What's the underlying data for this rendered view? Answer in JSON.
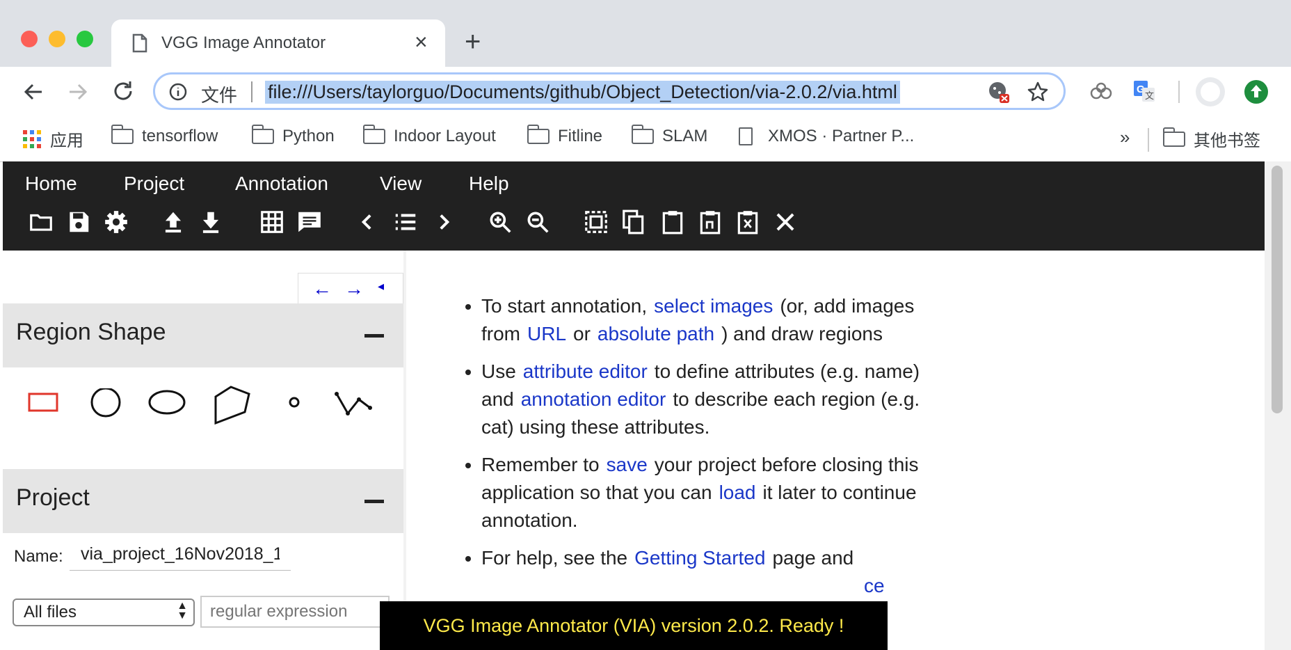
{
  "browser": {
    "tab_title": "VGG Image Annotator",
    "new_tab": "+",
    "tab_close": "×",
    "info_label": "文件",
    "url": "file:///Users/taylorguo/Documents/github/Object_Detection/via-2.0.2/via.html",
    "bookmarks": [
      {
        "label": "应用",
        "icon": "apps-grid-icon"
      },
      {
        "label": "tensorflow",
        "icon": "folder-icon"
      },
      {
        "label": "Python",
        "icon": "folder-icon"
      },
      {
        "label": "Indoor Layout",
        "icon": "folder-icon"
      },
      {
        "label": "Fitline",
        "icon": "folder-icon"
      },
      {
        "label": "SLAM",
        "icon": "folder-icon"
      },
      {
        "label": "XMOS · Partner P...",
        "icon": "page-icon"
      },
      {
        "label": "»",
        "icon": "overflow-icon"
      },
      {
        "label": "其他书签",
        "icon": "folder-icon"
      }
    ]
  },
  "via": {
    "menu": [
      "Home",
      "Project",
      "Annotation",
      "View",
      "Help"
    ],
    "toolbar_icons": [
      "open-folder-icon",
      "save-icon",
      "settings-icon",
      "upload-icon",
      "download-icon",
      "grid-icon",
      "comment-icon",
      "previous-icon",
      "list-icon",
      "next-icon",
      "zoom-in-icon",
      "zoom-out-icon",
      "select-all-icon",
      "copy-icon",
      "paste-icon",
      "paste-n-icon",
      "paste-clear-icon",
      "close-icon"
    ],
    "nav": {
      "left": "←",
      "right": "→",
      "toggle": "◂"
    },
    "region_shape": {
      "title": "Region Shape",
      "collapse": "–",
      "shapes": [
        "rectangle",
        "circle",
        "ellipse",
        "polygon",
        "point",
        "polyline"
      ],
      "selected": "rectangle",
      "selected_color": "#e0362b"
    },
    "project": {
      "title": "Project",
      "collapse": "–",
      "name_label": "Name:",
      "name_value": "via_project_16Nov2018_1",
      "filter_selected": "All files",
      "regex_placeholder": "regular expression"
    },
    "instructions": {
      "b1": {
        "pre": "To start annotation,",
        "l1": "select images",
        "m1": "(or, add images from",
        "l2": "URL",
        "m2": "or",
        "l3": "absolute path",
        "post": ") and draw regions"
      },
      "b2": {
        "pre": "Use",
        "l1": "attribute editor",
        "m1": "to define attributes (e.g. name) and",
        "l2": "annotation editor",
        "post": "to describe each region (e.g. cat) using these attributes."
      },
      "b3": {
        "pre": "Remember to",
        "l1": "save",
        "m1": "your project before closing this application so that you can",
        "l2": "load",
        "post": "it later to continue annotation."
      },
      "b4": {
        "pre": "For help, see the",
        "l1": "Getting Started",
        "post": "page and",
        "l2_fragment": "ce"
      }
    },
    "status": "VGG Image Annotator (VIA) version 2.0.2. Ready !"
  }
}
